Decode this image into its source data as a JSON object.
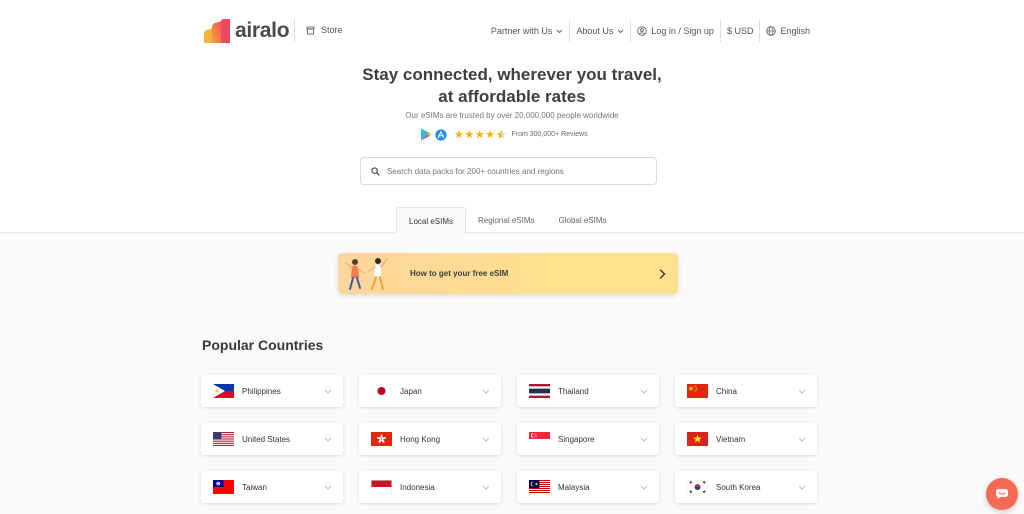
{
  "header": {
    "brand": "airalo",
    "store_label": "Store",
    "nav": {
      "partner": "Partner with Us",
      "about": "About Us",
      "login": "Log in / Sign up",
      "currency": "$ USD",
      "language": "English"
    }
  },
  "hero": {
    "title_line1": "Stay connected, wherever you travel,",
    "title_line2": "at affordable rates",
    "subtitle": "Our eSIMs are trusted by over 20,000,000 people worldwide",
    "reviews": "From 300,000+ Reviews",
    "rating_stars": 4.5
  },
  "search": {
    "placeholder": "Search data packs for 200+ countries and regions"
  },
  "tabs": [
    {
      "label": "Local eSIMs",
      "active": true
    },
    {
      "label": "Regional eSIMs",
      "active": false
    },
    {
      "label": "Global eSIMs",
      "active": false
    }
  ],
  "banner": {
    "text": "How to get your free eSIM"
  },
  "popular": {
    "title": "Popular Countries",
    "countries": [
      {
        "name": "Philippines",
        "flag": "philippines-flag"
      },
      {
        "name": "Japan",
        "flag": "japan-flag"
      },
      {
        "name": "Thailand",
        "flag": "thailand-flag"
      },
      {
        "name": "China",
        "flag": "china-flag"
      },
      {
        "name": "United States",
        "flag": "usa-flag"
      },
      {
        "name": "Hong Kong",
        "flag": "hong-kong-flag"
      },
      {
        "name": "Singapore",
        "flag": "singapore-flag"
      },
      {
        "name": "Vietnam",
        "flag": "vietnam-flag"
      },
      {
        "name": "Taiwan",
        "flag": "taiwan-flag"
      },
      {
        "name": "Indonesia",
        "flag": "indonesia-flag"
      },
      {
        "name": "Malaysia",
        "flag": "malaysia-flag"
      },
      {
        "name": "South Korea",
        "flag": "south-korea-flag"
      }
    ]
  },
  "colors": {
    "accent": "#f46a55",
    "banner_start": "#ffd59c",
    "banner_end": "#ffe08f",
    "star": "#f5b301"
  }
}
